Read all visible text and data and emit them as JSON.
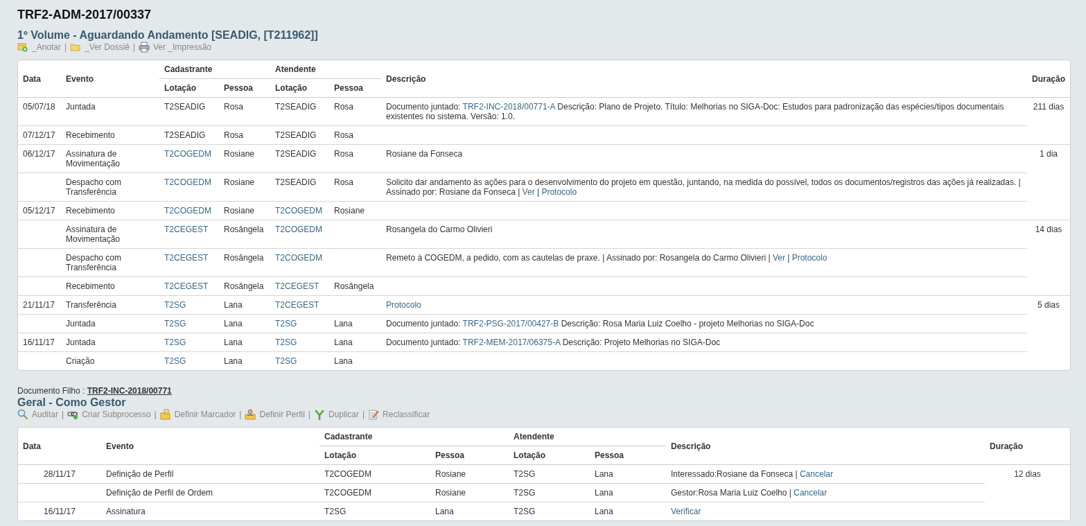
{
  "title": "TRF2-ADM-2017/00337",
  "sections": [
    {
      "heading": "1º Volume - Aguardando Andamento [SEADIG, [T211962]]",
      "separator": "|",
      "actions": [
        {
          "kind": "note",
          "label": "_Anotar"
        },
        {
          "kind": "folder",
          "label": "_Ver Dossiê"
        },
        {
          "kind": "printer",
          "label": "Ver _Impressão"
        }
      ],
      "table": {
        "header": {
          "date": "Data",
          "event": "Evento",
          "cad": "Cadastrante",
          "cad_lotacao": "Lotação",
          "cad_pessoa": "Pessoa",
          "at": "Atendente",
          "at_lotacao": "Lotação",
          "at_pessoa": "Pessoa",
          "description": "Descrição",
          "duration": "Duração"
        },
        "groups": [
          {
            "duration": "211 dias",
            "rows": [
              {
                "date": "05/07/18",
                "event": "Juntada",
                "cad_lotacao": "T2SEADIG",
                "cad_link": false,
                "cad_pessoa": "Rosa",
                "at_lotacao": "T2SEADIG",
                "at_link": false,
                "at_pessoa": "Rosa",
                "description": [
                  {
                    "text": "Documento juntado: ",
                    "link": false
                  },
                  {
                    "text": "TRF2-INC-2018/00771-A",
                    "link": true
                  },
                  {
                    "text": " Descrição: Plano de Projeto. Título: Melhorias no SIGA-Doc: Estudos para padronização das espécies/tipos documentais existentes no sistema. Versão: 1.0.",
                    "link": false
                  }
                ]
              },
              {
                "date": "07/12/17",
                "event": "Recebimento",
                "cad_lotacao": "T2SEADIG",
                "cad_link": false,
                "cad_pessoa": "Rosa",
                "at_lotacao": "T2SEADIG",
                "at_link": false,
                "at_pessoa": "Rosa"
              }
            ]
          },
          {
            "duration": "1 dia",
            "rows": [
              {
                "date": "06/12/17",
                "event": "Assinatura de Movimentação",
                "cad_lotacao": "T2COGEDM",
                "cad_link": true,
                "cad_pessoa": "Rosiane",
                "at_lotacao": "T2SEADIG",
                "at_link": false,
                "at_pessoa": "Rosa",
                "description": [
                  {
                    "text": "Rosiane da Fonseca",
                    "link": false
                  }
                ]
              },
              {
                "event": "Despacho com Transferência",
                "cad_lotacao": "T2COGEDM",
                "cad_link": true,
                "cad_pessoa": "Rosiane",
                "at_lotacao": "T2SEADIG",
                "at_link": false,
                "at_pessoa": "Rosa",
                "description": [
                  {
                    "text": "Solicito dar andamento às ações para o desenvolvimento do projeto em questão, juntando, na medida do possível, todos os documentos/registros das ações já realizadas. | Assinado por: Rosiane da Fonseca | ",
                    "link": false
                  },
                  {
                    "text": "Ver",
                    "link": true
                  },
                  {
                    "text": " | ",
                    "link": false
                  },
                  {
                    "text": "Protocolo",
                    "link": true
                  }
                ]
              },
              {
                "date": "05/12/17",
                "event": "Recebimento",
                "cad_lotacao": "T2COGEDM",
                "cad_link": true,
                "cad_pessoa": "Rosiane",
                "at_lotacao": "T2COGEDM",
                "at_link": true,
                "at_pessoa": "Rosiane"
              }
            ]
          },
          {
            "duration": "14 dias",
            "rows": [
              {
                "event": "Assinatura de Movimentação",
                "cad_lotacao": "T2CEGEST",
                "cad_link": true,
                "cad_pessoa": "Rosângela",
                "at_lotacao": "T2COGEDM",
                "at_link": true,
                "description": [
                  {
                    "text": "Rosangela do Carmo Olivieri",
                    "link": false
                  }
                ]
              },
              {
                "event": "Despacho com Transferência",
                "cad_lotacao": "T2CEGEST",
                "cad_link": true,
                "cad_pessoa": "Rosângela",
                "at_lotacao": "T2COGEDM",
                "at_link": true,
                "description": [
                  {
                    "text": "Remeto à COGEDM, a pedido, com as cautelas de praxe. | Assinado por: Rosangela do Carmo Olivieri | ",
                    "link": false
                  },
                  {
                    "text": "Ver",
                    "link": true
                  },
                  {
                    "text": " | ",
                    "link": false
                  },
                  {
                    "text": "Protocolo",
                    "link": true
                  }
                ]
              },
              {
                "event": "Recebimento",
                "cad_lotacao": "T2CEGEST",
                "cad_link": true,
                "cad_pessoa": "Rosângela",
                "at_lotacao": "T2CEGEST",
                "at_link": true,
                "at_pessoa": "Rosângela"
              }
            ]
          },
          {
            "duration": "5 dias",
            "rows": [
              {
                "date": "21/11/17",
                "event": "Transferência",
                "cad_lotacao": "T2SG",
                "cad_link": true,
                "cad_pessoa": "Lana",
                "at_lotacao": "T2CEGEST",
                "at_link": true,
                "description": [
                  {
                    "text": "Protocolo",
                    "link": true
                  }
                ]
              },
              {
                "event": "Juntada",
                "cad_lotacao": "T2SG",
                "cad_link": true,
                "cad_pessoa": "Lana",
                "at_lotacao": "T2SG",
                "at_link": true,
                "at_pessoa": "Lana",
                "description": [
                  {
                    "text": "Documento juntado: ",
                    "link": false
                  },
                  {
                    "text": "TRF2-PSG-2017/00427-B",
                    "link": true
                  },
                  {
                    "text": " Descrição: Rosa Maria Luiz Coelho - projeto Melhorias no SIGA-Doc",
                    "link": false
                  }
                ]
              },
              {
                "date": "16/11/17",
                "event": "Juntada",
                "cad_lotacao": "T2SG",
                "cad_link": true,
                "cad_pessoa": "Lana",
                "at_lotacao": "T2SG",
                "at_link": true,
                "at_pessoa": "Lana",
                "description": [
                  {
                    "text": "Documento juntado: ",
                    "link": false
                  },
                  {
                    "text": "TRF2-MEM-2017/06375-A",
                    "link": true
                  },
                  {
                    "text": " Descrição: Projeto Melhorias no SIGA-Doc",
                    "link": false
                  }
                ]
              },
              {
                "event": "Criação",
                "cad_lotacao": "T2SG",
                "cad_link": true,
                "cad_pessoa": "Lana",
                "at_lotacao": "T2SG",
                "at_link": true,
                "at_pessoa": "Lana"
              }
            ]
          }
        ]
      }
    },
    {
      "child_doc": {
        "label": "Documento Filho :",
        "link": "TRF2-INC-2018/00771"
      },
      "heading": "Geral - Como Gestor",
      "separator": "|",
      "actions": [
        {
          "kind": "magnifier",
          "label": "Auditar"
        },
        {
          "kind": "chain",
          "label": "Criar Subprocesso"
        },
        {
          "kind": "marker",
          "label": "Definir Marcador"
        },
        {
          "kind": "person",
          "label": "Definir Perfil"
        },
        {
          "kind": "fork",
          "label": "Duplicar"
        },
        {
          "kind": "edit",
          "label": "Reclassificar"
        }
      ],
      "table": {
        "header": {
          "date": "Data",
          "event": "Evento",
          "cad": "Cadastrante",
          "cad_lotacao": "Lotação",
          "cad_pessoa": "Pessoa",
          "at": "Atendente",
          "at_lotacao": "Lotação",
          "at_pessoa": "Pessoa",
          "description": "Descrição",
          "duration": "Duração"
        },
        "groups": [
          {
            "duration": "12 dias",
            "rows": [
              {
                "date": "28/11/17",
                "event": "Definição de Perfil",
                "cad_lotacao": "T2COGEDM",
                "cad_link": false,
                "cad_pessoa": "Rosiane",
                "at_lotacao": "T2SG",
                "at_link": false,
                "at_pessoa": "Lana",
                "description": [
                  {
                    "text": "Interessado:Rosiane da Fonseca | ",
                    "link": false
                  },
                  {
                    "text": "Cancelar",
                    "link": true
                  }
                ]
              },
              {
                "event": "Definição de Perfil de Ordem",
                "cad_lotacao": "T2COGEDM",
                "cad_link": false,
                "cad_pessoa": "Rosiane",
                "at_lotacao": "T2SG",
                "at_link": false,
                "at_pessoa": "Lana",
                "description": [
                  {
                    "text": "Gestor:Rosa Maria Luiz Coelho | ",
                    "link": false
                  },
                  {
                    "text": "Cancelar",
                    "link": true
                  }
                ]
              },
              {
                "date": "16/11/17",
                "event": "Assinatura",
                "cad_lotacao": "T2SG",
                "cad_link": false,
                "cad_pessoa": "Lana",
                "at_lotacao": "T2SG",
                "at_link": false,
                "at_pessoa": "Lana",
                "description": [
                  {
                    "text": "Verificar",
                    "link": true
                  }
                ]
              }
            ]
          }
        ]
      }
    }
  ]
}
